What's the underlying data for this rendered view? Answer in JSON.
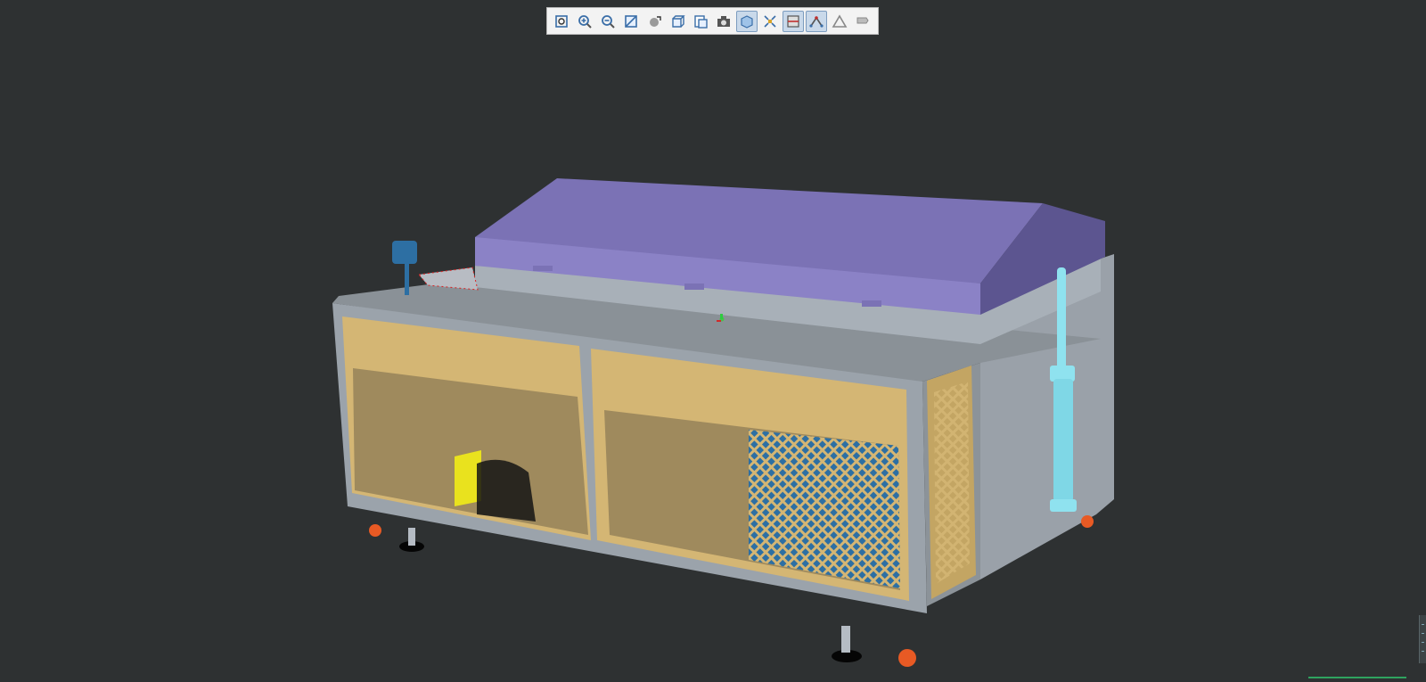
{
  "app": {
    "view": "3D model viewer"
  },
  "toolbar": {
    "buttons": [
      {
        "name": "zoom-fit",
        "icon": "zoom-fit-icon",
        "active": false
      },
      {
        "name": "zoom-in",
        "icon": "zoom-in-icon",
        "active": false
      },
      {
        "name": "zoom-out",
        "icon": "zoom-out-icon",
        "active": false
      },
      {
        "name": "zoom-window",
        "icon": "zoom-window-icon",
        "active": false
      },
      {
        "name": "rotate",
        "icon": "rotate-icon",
        "active": false
      },
      {
        "name": "view-cube",
        "icon": "view-cube-icon",
        "active": false
      },
      {
        "name": "standard-views",
        "icon": "standard-views-icon",
        "active": false
      },
      {
        "name": "screenshot",
        "icon": "camera-icon",
        "active": false
      },
      {
        "name": "shaded-display",
        "icon": "shaded-display-icon",
        "active": true
      },
      {
        "name": "explode",
        "icon": "explode-icon",
        "active": false
      },
      {
        "name": "section",
        "icon": "section-icon",
        "active": true
      },
      {
        "name": "measure",
        "icon": "measure-icon",
        "active": true
      },
      {
        "name": "triangle-markup",
        "icon": "triangle-markup-icon",
        "active": false
      },
      {
        "name": "annotation",
        "icon": "annotation-icon",
        "active": false
      }
    ]
  },
  "model": {
    "lid_color": "#7b72b5",
    "cabinet_color": "#9aa2ab",
    "panel_color": "#d4b674",
    "accent_colors": {
      "blue_mesh": "#2d6fa3",
      "yellow_block": "#e9e21e",
      "piston": "#8fe2ef",
      "caster": "#e85a24"
    }
  }
}
